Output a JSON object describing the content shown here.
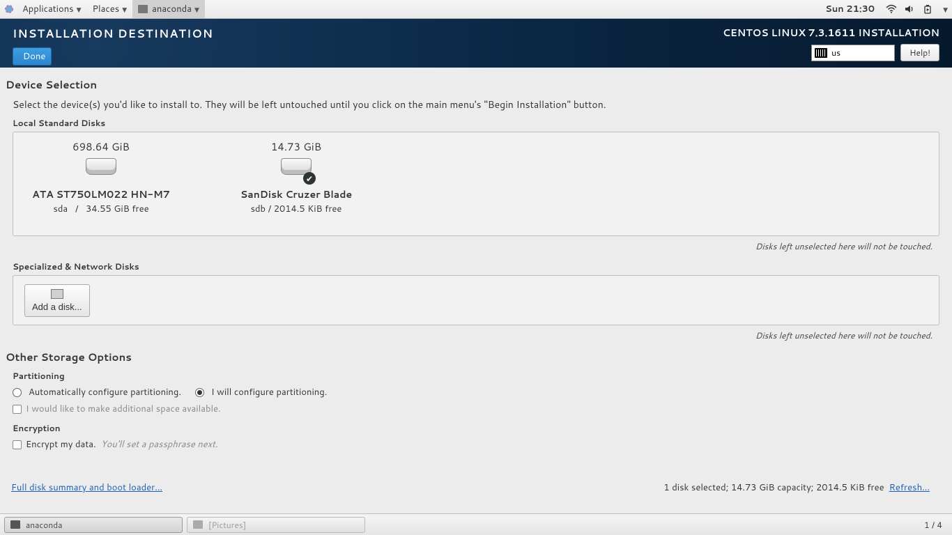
{
  "panel": {
    "applications": "Applications",
    "places": "Places",
    "app": "anaconda",
    "clock": "Sun 21:30"
  },
  "header": {
    "title": "INSTALLATION DESTINATION",
    "done": "Done",
    "distro": "CENTOS LINUX 7.3.1611 INSTALLATION",
    "kbd": "us",
    "help": "Help!"
  },
  "section": {
    "device_selection": "Device Selection",
    "intro": "Select the device(s) you'd like to install to.  They will be left untouched until you click on the main menu's \"Begin Installation\" button.",
    "local_disks": "Local Standard Disks",
    "net_disks": "Specialized & Network Disks",
    "other": "Other Storage Options",
    "partitioning": "Partitioning",
    "encryption": "Encryption",
    "unsel_note": "Disks left unselected here will not be touched."
  },
  "disks": [
    {
      "size": "698.64 GiB",
      "model": "ATA ST750LM022 HN-M7",
      "dev": "sda",
      "sep": "/",
      "free": "34.55 GiB free",
      "selected": false
    },
    {
      "size": "14.73 GiB",
      "model": "SanDisk Cruzer Blade",
      "dev": "sdb",
      "sep": "/",
      "free": "2014.5 KiB free",
      "selected": true
    }
  ],
  "adddisk": "Add a disk...",
  "part": {
    "auto": "Automatically configure partitioning.",
    "manual": "I will configure partitioning.",
    "reclaim": "I would like to make additional space available."
  },
  "enc": {
    "label": "Encrypt my data.",
    "hint": "You'll set a passphrase next."
  },
  "footer": {
    "link": "Full disk summary and boot loader...",
    "summary": "1 disk selected; 14.73 GiB capacity; 2014.5 KiB free",
    "refresh": "Refresh..."
  },
  "taskbar": {
    "t1": "anaconda",
    "t2": "[Pictures]",
    "ws": "1 / 4"
  }
}
